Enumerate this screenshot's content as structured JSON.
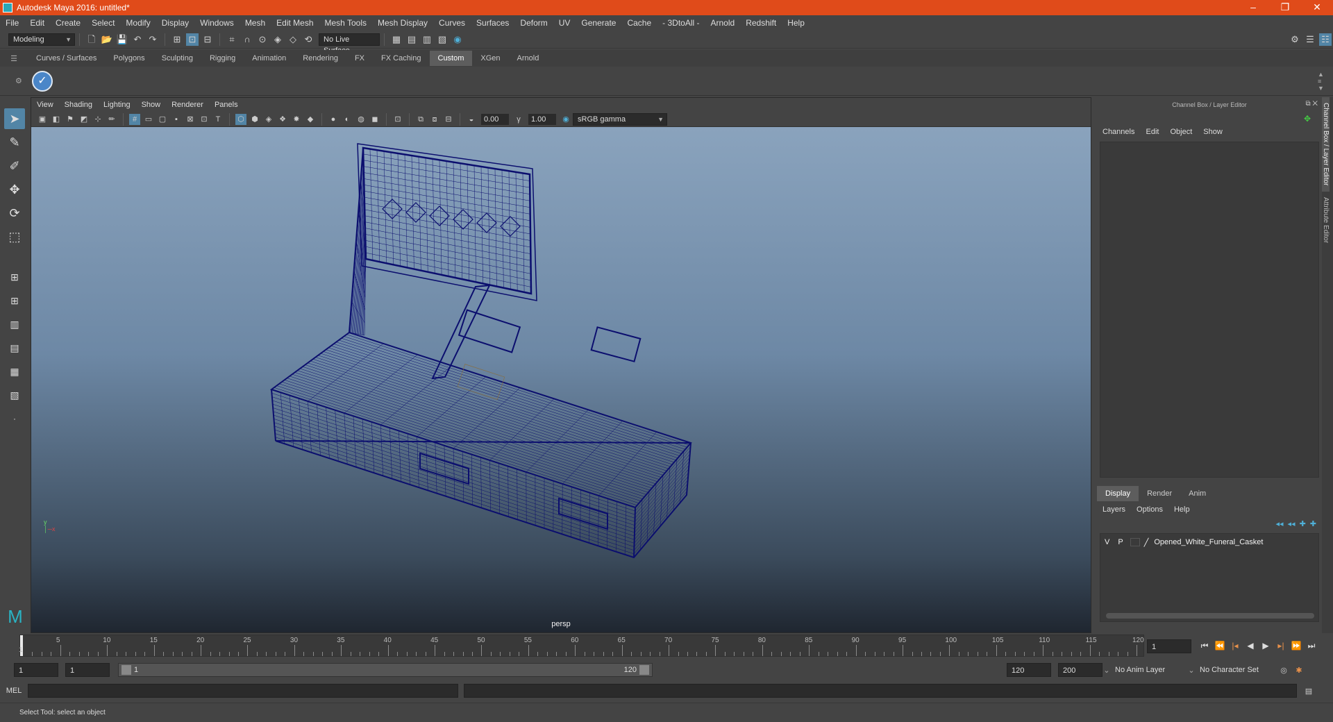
{
  "titlebar": {
    "title": "Autodesk Maya 2016: untitled*"
  },
  "menubar": {
    "items": [
      "File",
      "Edit",
      "Create",
      "Select",
      "Modify",
      "Display",
      "Windows",
      "Mesh",
      "Edit Mesh",
      "Mesh Tools",
      "Mesh Display",
      "Curves",
      "Surfaces",
      "Deform",
      "UV",
      "Generate",
      "Cache",
      "- 3DtoAll -",
      "Arnold",
      "Redshift",
      "Help"
    ]
  },
  "statusline": {
    "mode": "Modeling",
    "live_surface": "No Live Surface"
  },
  "shelf": {
    "tabs": [
      "Curves / Surfaces",
      "Polygons",
      "Sculpting",
      "Rigging",
      "Animation",
      "Rendering",
      "FX",
      "FX Caching",
      "Custom",
      "XGen",
      "Arnold"
    ],
    "active_tab": "Custom"
  },
  "viewport": {
    "menu": [
      "View",
      "Shading",
      "Lighting",
      "Show",
      "Renderer",
      "Panels"
    ],
    "exposure": "0.00",
    "gamma": "1.00",
    "color_space": "sRGB gamma",
    "camera_label": "persp",
    "wire_color": "#0b0e6e"
  },
  "channelbox": {
    "header": "Channel Box / Layer Editor",
    "menu": [
      "Channels",
      "Edit",
      "Object",
      "Show"
    ],
    "layer_tabs": [
      "Display",
      "Render",
      "Anim"
    ],
    "active_layer_tab": "Display",
    "layer_menu": [
      "Layers",
      "Options",
      "Help"
    ],
    "layers": [
      {
        "v": "V",
        "p": "P",
        "name": "Opened_White_Funeral_Casket"
      }
    ]
  },
  "sidetabs": [
    "Channel Box / Layer Editor",
    "Attribute Editor"
  ],
  "timeline": {
    "ticks": [
      "5",
      "10",
      "15",
      "20",
      "25",
      "30",
      "35",
      "40",
      "45",
      "50",
      "55",
      "60",
      "65",
      "70",
      "75",
      "80",
      "85",
      "90",
      "95",
      "100",
      "105",
      "110",
      "115",
      "120"
    ],
    "current_frame": "1",
    "current_frame_field": "1"
  },
  "range": {
    "start": "1",
    "playback_start": "1",
    "slider_start": "1",
    "slider_end": "120",
    "playback_end": "120",
    "end": "200",
    "anim_layer": "No Anim Layer",
    "character_set": "No Character Set"
  },
  "cmdline": {
    "label": "MEL"
  },
  "helpline": {
    "text": "Select Tool: select an object"
  }
}
